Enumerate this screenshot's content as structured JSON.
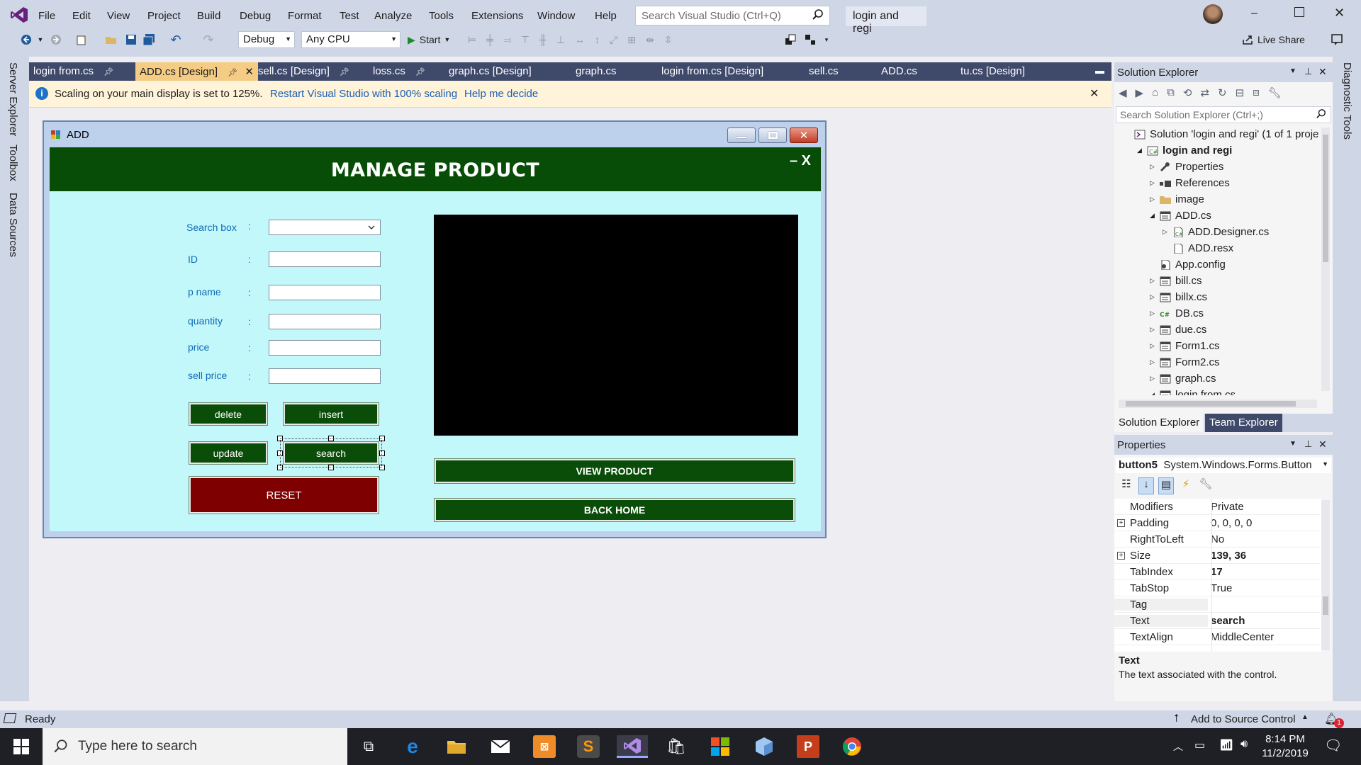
{
  "menu": [
    "File",
    "Edit",
    "View",
    "Project",
    "Build",
    "Debug",
    "Format",
    "Test",
    "Analyze",
    "Tools",
    "Extensions",
    "Window",
    "Help"
  ],
  "search_placeholder": "Search Visual Studio (Ctrl+Q)",
  "project_name": "login and regi",
  "toolbar": {
    "config": "Debug",
    "platform": "Any CPU",
    "start_label": "Start",
    "live_share": "Live Share"
  },
  "left_strip": [
    "Server Explorer",
    "Toolbox",
    "Data Sources"
  ],
  "right_strip": "Diagnostic Tools",
  "doc_tabs": [
    "login from.cs",
    "ADD.cs [Design]",
    "sell.cs [Design]",
    "loss.cs",
    "graph.cs [Design]",
    "graph.cs",
    "login from.cs [Design]",
    "sell.cs",
    "ADD.cs",
    "tu.cs [Design]"
  ],
  "infobar": {
    "message": "Scaling on your main display is set to 125%.",
    "link1": "Restart Visual Studio with 100% scaling",
    "link2": "Help me decide"
  },
  "form": {
    "title": "ADD",
    "header": "MANAGE PRODUCT",
    "header_controls": "– X",
    "fields": [
      {
        "label": "Search box",
        "type": "combo"
      },
      {
        "label": "ID",
        "type": "text"
      },
      {
        "label": "p name",
        "type": "text"
      },
      {
        "label": "quantity",
        "type": "text"
      },
      {
        "label": "price",
        "type": "text"
      },
      {
        "label": "sell price",
        "type": "text"
      }
    ],
    "colon": ":",
    "buttons": {
      "delete": "delete",
      "insert": "insert",
      "update": "update",
      "search": "search",
      "reset": "RESET",
      "view": "VIEW PRODUCT",
      "back": "BACK HOME"
    }
  },
  "solution_explorer": {
    "title": "Solution Explorer",
    "search_placeholder": "Search Solution Explorer (Ctrl+;)",
    "items": [
      {
        "label": "Solution 'login and regi' (1 of 1 proje",
        "depth": 0,
        "arrow": "",
        "icon": "solution"
      },
      {
        "label": "login and regi",
        "depth": 1,
        "arrow": "open",
        "icon": "csproj",
        "bold": true
      },
      {
        "label": "Properties",
        "depth": 2,
        "arrow": "closed",
        "icon": "wrench"
      },
      {
        "label": "References",
        "depth": 2,
        "arrow": "closed",
        "icon": "refs"
      },
      {
        "label": "image",
        "depth": 2,
        "arrow": "closed",
        "icon": "folder"
      },
      {
        "label": "ADD.cs",
        "depth": 2,
        "arrow": "open",
        "icon": "form"
      },
      {
        "label": "ADD.Designer.cs",
        "depth": 3,
        "arrow": "closed",
        "icon": "csfile"
      },
      {
        "label": "ADD.resx",
        "depth": 3,
        "arrow": "",
        "icon": "resx"
      },
      {
        "label": "App.config",
        "depth": 2,
        "arrow": "",
        "icon": "config"
      },
      {
        "label": "bill.cs",
        "depth": 2,
        "arrow": "closed",
        "icon": "form"
      },
      {
        "label": "billx.cs",
        "depth": 2,
        "arrow": "closed",
        "icon": "form"
      },
      {
        "label": "DB.cs",
        "depth": 2,
        "arrow": "closed",
        "icon": "csclass"
      },
      {
        "label": "due.cs",
        "depth": 2,
        "arrow": "closed",
        "icon": "form"
      },
      {
        "label": "Form1.cs",
        "depth": 2,
        "arrow": "closed",
        "icon": "form"
      },
      {
        "label": "Form2.cs",
        "depth": 2,
        "arrow": "closed",
        "icon": "form"
      },
      {
        "label": "graph.cs",
        "depth": 2,
        "arrow": "closed",
        "icon": "form"
      },
      {
        "label": "login from.cs",
        "depth": 2,
        "arrow": "open",
        "icon": "form"
      }
    ],
    "tabs": [
      "Solution Explorer",
      "Team Explorer"
    ]
  },
  "properties": {
    "title": "Properties",
    "object": "button5",
    "object_type": "System.Windows.Forms.Button",
    "rows": [
      {
        "name": "Modifiers",
        "value": "Private",
        "expand": false,
        "bold": false
      },
      {
        "name": "Padding",
        "value": "0, 0, 0, 0",
        "expand": true,
        "bold": false
      },
      {
        "name": "RightToLeft",
        "value": "No",
        "expand": false,
        "bold": false
      },
      {
        "name": "Size",
        "value": "139, 36",
        "expand": true,
        "bold": true
      },
      {
        "name": "TabIndex",
        "value": "17",
        "expand": false,
        "bold": true
      },
      {
        "name": "TabStop",
        "value": "True",
        "expand": false,
        "bold": false
      },
      {
        "name": "Tag",
        "value": "",
        "expand": false,
        "bold": false
      },
      {
        "name": "Text",
        "value": "search",
        "expand": false,
        "bold": true
      },
      {
        "name": "TextAlign",
        "value": "MiddleCenter",
        "expand": false,
        "bold": false
      }
    ],
    "desc_title": "Text",
    "desc_text": "The text associated with the control."
  },
  "status": {
    "ready": "Ready",
    "source_control": "Add to Source Control",
    "notif_count": "1"
  },
  "taskbar": {
    "search_placeholder": "Type here to search",
    "time": "8:14 PM",
    "date": "11/2/2019"
  },
  "colors": {
    "accent": "#0a4d08",
    "reset": "#7f0000",
    "canvas": "#c3f8fb",
    "tab_active": "#f5cc84"
  }
}
